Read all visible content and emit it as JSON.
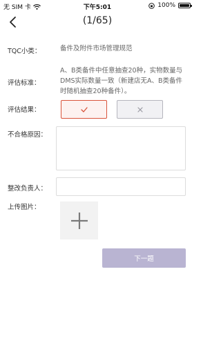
{
  "status_bar": {
    "carrier": "无 SIM 卡",
    "time": "下午5:01",
    "battery": "100%"
  },
  "nav": {
    "title": "(1/65)",
    "back_icon": "chevron-left-icon"
  },
  "form": {
    "tqc_category": {
      "label": "TQC小类：",
      "value": "备件及附件市场管理规范"
    },
    "standard": {
      "label": "评估标准：",
      "value": "A、B类备件中任意抽查20种，实物数量与DMS实际数量一致（新建店无A、B类备件时随机抽查20种备件）。"
    },
    "result": {
      "label": "评估结果：",
      "pass_icon": "check-icon",
      "fail_icon": "x-icon",
      "selected": "pass",
      "pass_color": "#d9533a"
    },
    "reason": {
      "label": "不合格原因：",
      "value": ""
    },
    "owner": {
      "label": "整改负责人：",
      "value": ""
    },
    "photos": {
      "label": "上传图片：",
      "add_icon": "plus-icon"
    }
  },
  "footer": {
    "next_label": "下一题",
    "next_color": "#b9b4d2"
  }
}
